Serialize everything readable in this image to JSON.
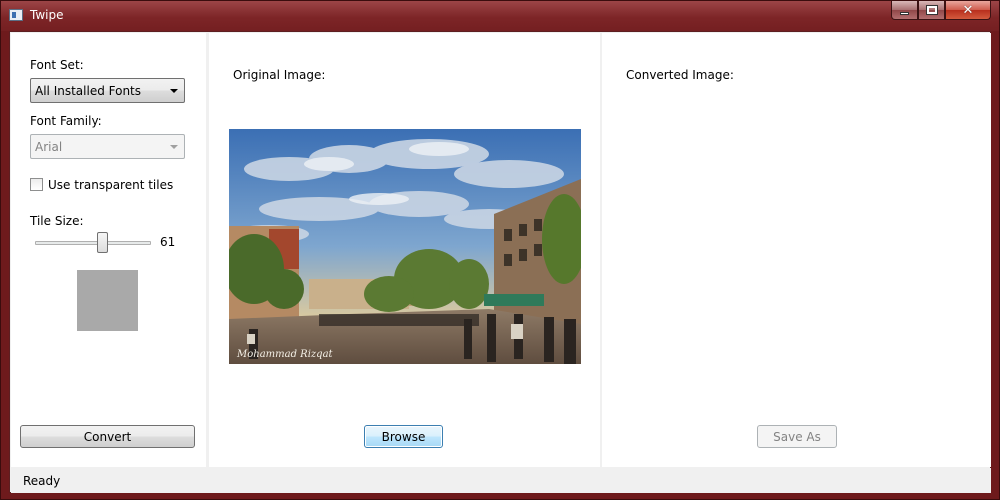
{
  "window": {
    "title": "Twipe"
  },
  "left_panel": {
    "font_set_label": "Font Set:",
    "font_set_value": "All Installed Fonts",
    "font_family_label": "Font Family:",
    "font_family_value": "Arial",
    "transparent_tiles_label": "Use transparent tiles",
    "transparent_tiles_checked": false,
    "tile_size_label": "Tile Size:",
    "tile_size_value": "61",
    "convert_label": "Convert"
  },
  "original": {
    "label": "Original Image:",
    "browse_label": "Browse",
    "photo_signature": "Mohammad Rizqat"
  },
  "converted": {
    "label": "Converted Image:",
    "save_as_label": "Save As"
  },
  "status": {
    "text": "Ready"
  },
  "colors": {
    "titlebar": "#7d2527",
    "tile_preview": "#a9a9a9",
    "focus_blue": "#3c7fb1"
  }
}
